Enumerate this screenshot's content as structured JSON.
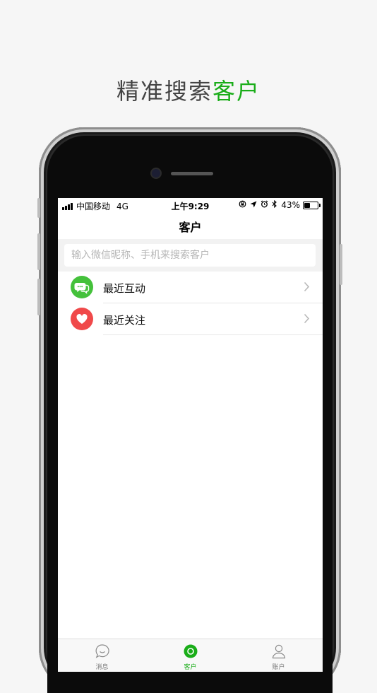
{
  "promo": {
    "title_part1": "精准搜索",
    "title_part2": "客户"
  },
  "colors": {
    "accent": "#1aad19",
    "interaction_icon_bg": "#44c13b",
    "follow_icon_bg": "#f0494a"
  },
  "status_bar": {
    "carrier": "中国移动",
    "network": "4G",
    "time": "上午9:29",
    "battery": "43%",
    "battery_level": 0.43
  },
  "nav": {
    "title": "客户"
  },
  "search": {
    "placeholder": "输入微信昵称、手机来搜索客户",
    "value": ""
  },
  "list": {
    "items": [
      {
        "label": "最近互动",
        "icon": "chat-bubbles-icon"
      },
      {
        "label": "最近关注",
        "icon": "heart-icon"
      }
    ]
  },
  "tabs": [
    {
      "label": "消息",
      "icon": "message-bubble-icon",
      "active": false
    },
    {
      "label": "客户",
      "icon": "customer-circle-icon",
      "active": true
    },
    {
      "label": "账户",
      "icon": "person-icon",
      "active": false
    }
  ]
}
